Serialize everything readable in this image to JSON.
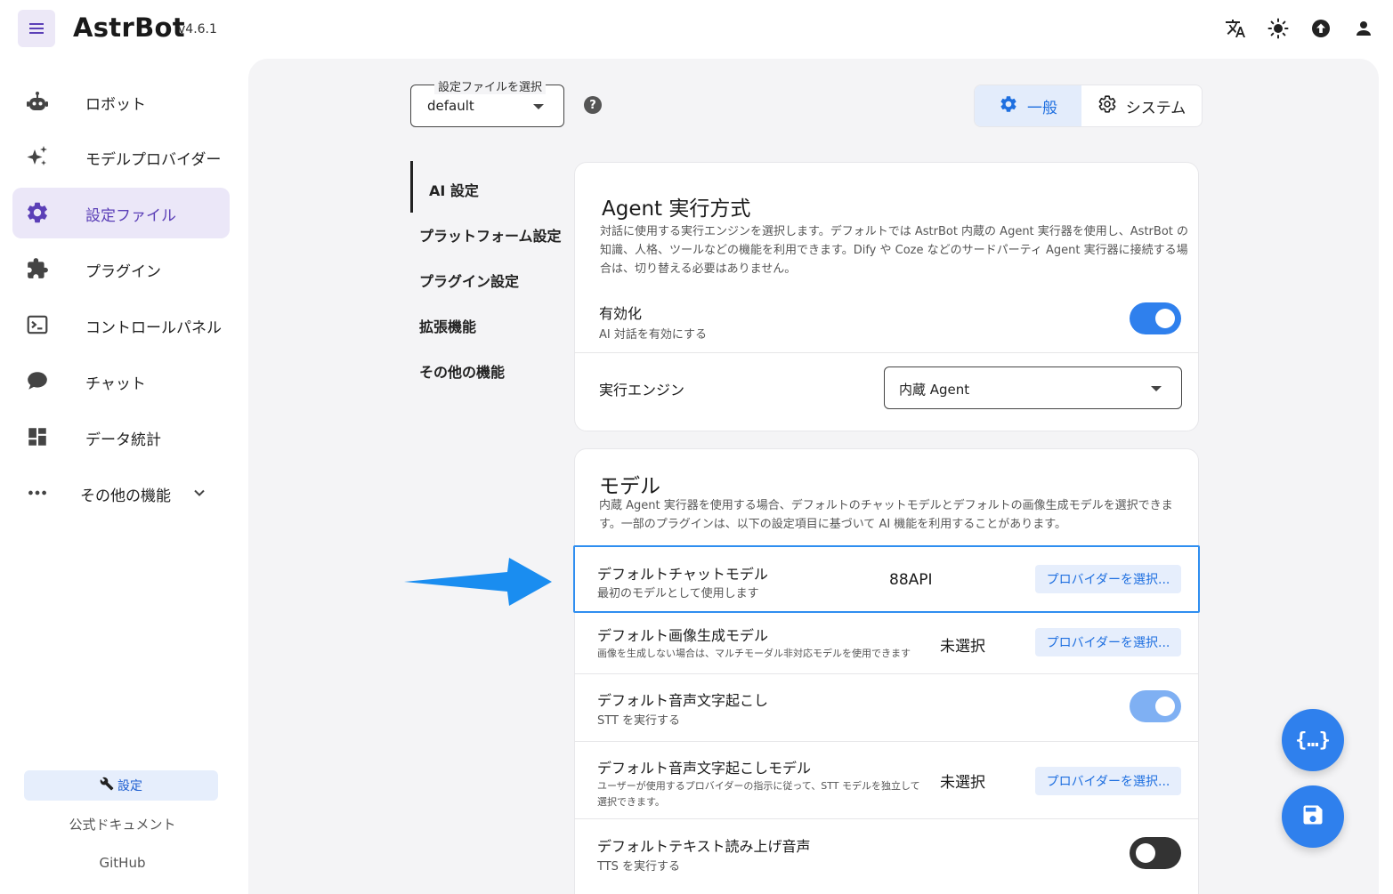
{
  "app": {
    "name": "AstrBot",
    "version": "v4.6.1"
  },
  "sidebar": {
    "items": [
      {
        "label": "ロボット",
        "icon": "robot-icon"
      },
      {
        "label": "モデルプロバイダー",
        "icon": "sparkle-icon"
      },
      {
        "label": "設定ファイル",
        "icon": "gear-icon",
        "active": true
      },
      {
        "label": "プラグイン",
        "icon": "puzzle-icon"
      },
      {
        "label": "コントロールパネル",
        "icon": "terminal-icon"
      },
      {
        "label": "チャット",
        "icon": "chat-bubble-icon"
      },
      {
        "label": "データ統計",
        "icon": "dashboard-icon"
      },
      {
        "label": "その他の機能",
        "icon": "more-dots-icon"
      }
    ],
    "settings_label": "設定",
    "docs_label": "公式ドキュメント",
    "github_label": "GitHub"
  },
  "config_selector": {
    "legend": "設定ファイルを選択",
    "value": "default"
  },
  "tabs": [
    {
      "label": "一般",
      "active": true
    },
    {
      "label": "システム",
      "active": false
    }
  ],
  "section_nav": [
    "AI 設定",
    "プラットフォーム設定",
    "プラグイン設定",
    "拡張機能",
    "その他の機能"
  ],
  "agent_card": {
    "title": "Agent 実行方式",
    "desc": "対話に使用する実行エンジンを選択します。デフォルトでは AstrBot 内蔵の Agent 実行器を使用し、AstrBot の知識、人格、ツールなどの機能を利用できます。Dify や Coze などのサードパーティ Agent 実行器に接続する場合は、切り替える必要はありません。",
    "enable_title": "有効化",
    "enable_sub": "AI 対話を有効にする",
    "enabled": true,
    "engine_label": "実行エンジン",
    "engine_value": "内蔵 Agent"
  },
  "model_card": {
    "title": "モデル",
    "desc": "内蔵 Agent 実行器を使用する場合、デフォルトのチャットモデルとデフォルトの画像生成モデルを選択できます。一部のプラグインは、以下の設定項目に基づいて AI 機能を利用することがあります。",
    "rows": [
      {
        "title": "デフォルトチャットモデル",
        "sub": "最初のモデルとして使用します",
        "value": "88API",
        "button": "プロバイダーを選択..."
      },
      {
        "title": "デフォルト画像生成モデル",
        "sub": "画像を生成しない場合は、マルチモーダル非対応モデルを使用できます",
        "value": "未選択",
        "button": "プロバイダーを選択..."
      },
      {
        "title": "デフォルト音声文字起こし",
        "sub": "STT を実行する",
        "toggle": true
      },
      {
        "title": "デフォルト音声文字起こしモデル",
        "sub": "ユーザーが使用するプロバイダーの指示に従って、STT モデルを独立して",
        "sub2": "選択できます。",
        "value": "未選択",
        "button": "プロバイダーを選択..."
      },
      {
        "title": "デフォルトテキスト読み上げ音声",
        "sub": "TTS を実行する",
        "toggle": false
      }
    ]
  },
  "colors": {
    "accent": "#2f80ed",
    "brand_purple": "#5b3fb7",
    "highlight_border": "#2f8ef0"
  },
  "fabs": [
    "code-braces-icon",
    "save-icon"
  ]
}
